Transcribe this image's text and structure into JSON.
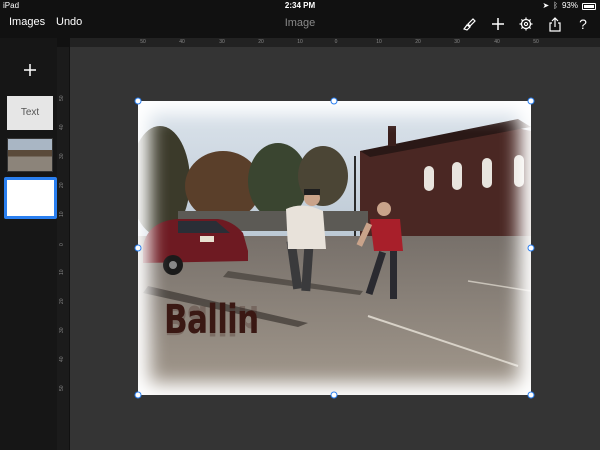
{
  "status_bar": {
    "device": "iPad",
    "time": "2:34 PM",
    "battery": "93%"
  },
  "toolbar": {
    "images_label": "Images",
    "undo_label": "Undo",
    "title": "Image",
    "icons": [
      "paintbrush-icon",
      "plus-icon",
      "gear-icon",
      "share-icon",
      "help-icon"
    ],
    "help_glyph": "?"
  },
  "ruler": {
    "horizontal_ticks": [
      "50",
      "40",
      "30",
      "20",
      "10",
      "0",
      "10",
      "20",
      "30",
      "40",
      "50"
    ],
    "vertical_ticks": [
      "50",
      "40",
      "30",
      "20",
      "10",
      "0",
      "10",
      "20",
      "30",
      "40",
      "50"
    ]
  },
  "sidebar": {
    "add_glyph": "+",
    "slides": [
      {
        "label": "Text"
      },
      {
        "label": ""
      },
      {
        "label": ""
      }
    ],
    "selected_index": 2
  },
  "slide": {
    "caption": "Ballin",
    "selection_color": "#2a7ff0"
  },
  "colors": {
    "accent": "#2a7ff0",
    "canvas_bg": "#343434",
    "caption": "#3a1813"
  }
}
